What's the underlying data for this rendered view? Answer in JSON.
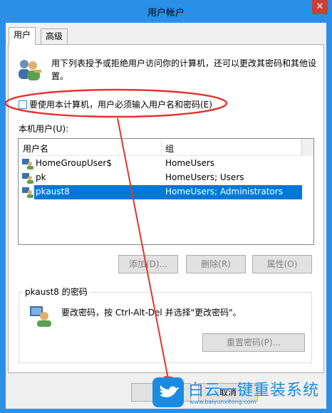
{
  "window": {
    "title": "用户帐户",
    "close_glyph": "✕"
  },
  "tabs": [
    {
      "label": "用户",
      "active": true
    },
    {
      "label": "高级",
      "active": false
    }
  ],
  "description": "用下列表授予或拒绝用户访问你的计算机，还可以更改其密码和其他设置。",
  "require_password_checkbox": {
    "label": "要使用本计算机，用户必须输入用户名和密码(E)",
    "checked": false
  },
  "local_users": {
    "label": "本机用户(U):",
    "columns": [
      "用户名",
      "组"
    ],
    "rows": [
      {
        "name": "HomeGroupUser$",
        "group": "HomeUsers",
        "selected": false
      },
      {
        "name": "pk",
        "group": "HomeUsers; Users",
        "selected": false
      },
      {
        "name": "pkaust8",
        "group": "HomeUsers; Administrators",
        "selected": true
      }
    ]
  },
  "buttons": {
    "add": "添加(D)...",
    "remove": "删除(R)",
    "properties": "属性(O)",
    "reset_password": "重置密码(P)...",
    "ok": "",
    "cancel": "取消"
  },
  "password_group": {
    "title": "pkaust8 的密码",
    "text": "要改密码，按 Ctrl-Alt-Del 并选择\"更改密码\"。"
  },
  "watermark": {
    "title": "白云一键重装系统",
    "url": "www.baiyunxitong.com"
  },
  "colors": {
    "accent": "#2b8fe8",
    "selection": "#0078d7",
    "annotation": "#e3342f",
    "close": "#c7403a"
  }
}
